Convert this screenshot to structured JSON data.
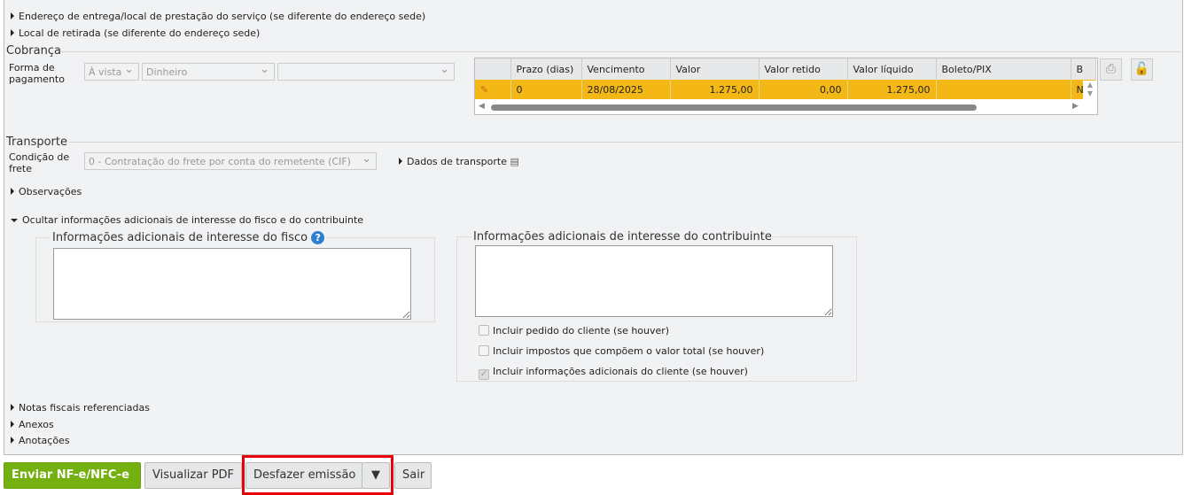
{
  "sections": {
    "delivery": "Endereço de entrega/local de prestação do serviço (se diferente do endereço sede)",
    "pickup": "Local de retirada (se diferente do endereço sede)",
    "observacoes": "Observações",
    "hide_additional": "Ocultar informações adicionais de interesse do fisco e do contribuinte",
    "notas_ref": "Notas fiscais referenciadas",
    "anexos": "Anexos",
    "anotacoes": "Anotações"
  },
  "cobranca": {
    "title": "Cobrança",
    "label": "Forma de pagamento",
    "condition": "À vista",
    "method": "Dinheiro",
    "third": "",
    "table": {
      "columns": [
        "",
        "Prazo (dias)",
        "Vencimento",
        "Valor",
        "Valor retido",
        "Valor líquido",
        "Boleto/PIX",
        "B"
      ],
      "rows": [
        [
          "",
          "0",
          "28/08/2025",
          "1.275,00",
          "0,00",
          "1.275,00",
          "",
          "N"
        ]
      ]
    }
  },
  "transporte": {
    "title": "Transporte",
    "label": "Condição de frete",
    "value": "0 - Contratação do frete por conta do remetente (CIF)",
    "dados": "Dados de transporte"
  },
  "info": {
    "fisco_title": "Informações adicionais de interesse do fisco",
    "contrib_title": "Informações adicionais de interesse do contribuinte",
    "fisco_value": "",
    "contrib_value": "",
    "checks": [
      {
        "label": "Incluir pedido do cliente (se houver)",
        "checked": false
      },
      {
        "label": "Incluir impostos que compõem o valor total (se houver)",
        "checked": false
      },
      {
        "label": "Incluir informações adicionais do cliente (se houver)",
        "checked": true
      }
    ]
  },
  "footer": {
    "send": "Enviar NF-e/NFC-e",
    "pdf": "Visualizar PDF",
    "undo": "Desfazer emissão",
    "exit": "Sair",
    "accent": "#74b00f",
    "highlight": "#e8000b"
  }
}
